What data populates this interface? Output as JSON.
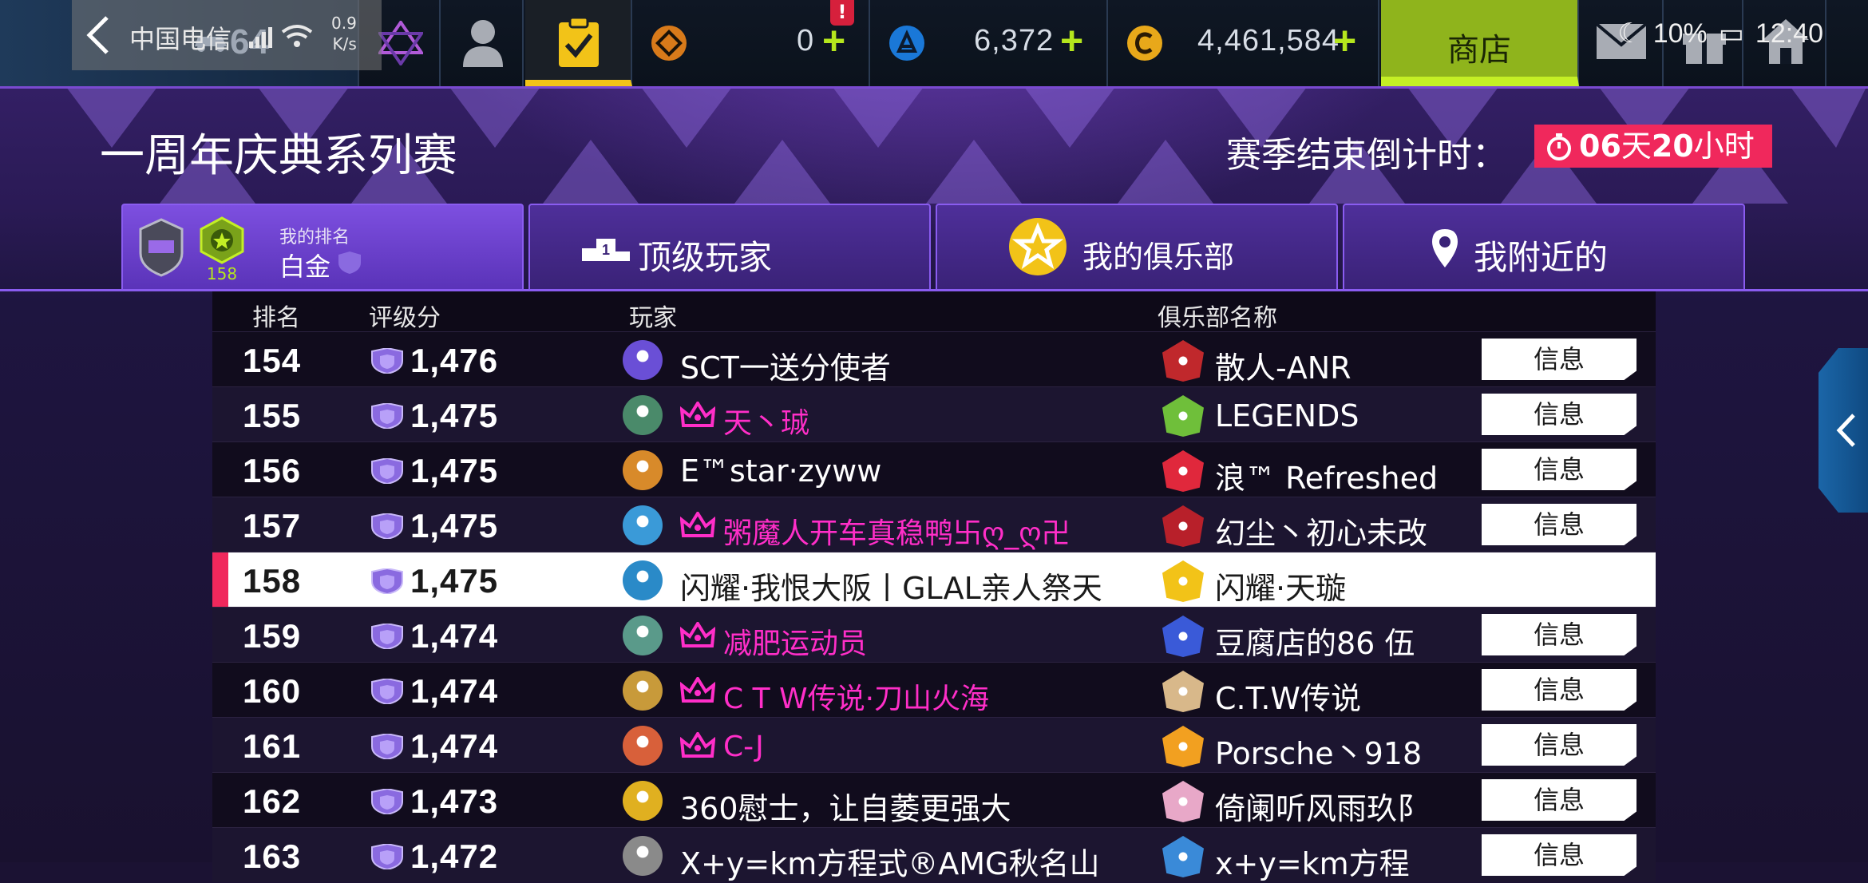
{
  "status_bar": {
    "carrier": "中国电信",
    "network_speed_value": "0.9",
    "network_speed_unit": "K/s",
    "battery": "10%",
    "time": "12:40"
  },
  "top_bar": {
    "car_count": "64",
    "alert_badge": "!",
    "tokens_value": "0",
    "blueprints_value": "6,372",
    "credits_value": "4,461,584",
    "shop_label": "商店",
    "plus_symbol": "+"
  },
  "header": {
    "title": "一周年庆典系列赛",
    "countdown_label": "赛季结束倒计时：",
    "countdown_days": "06",
    "countdown_days_unit": "天",
    "countdown_hours": "20",
    "countdown_hours_unit": "小时"
  },
  "tabs": {
    "my_rank_label": "我的排名",
    "my_rank_tier": "白金",
    "my_level": "158",
    "top_players": "顶级玩家",
    "podium_number": "1",
    "my_club": "我的俱乐部",
    "nearby": "我附近的"
  },
  "table": {
    "headers": {
      "rank": "排名",
      "score": "评级分",
      "player": "玩家",
      "club": "俱乐部名称"
    },
    "info_label": "信息",
    "rows": [
      {
        "rank": "154",
        "score": "1,476",
        "player": "SCT一送分使者",
        "vip": false,
        "club": "散人-ANR",
        "info": true,
        "avatar": "#6a4fd6",
        "logo": "#c0282c"
      },
      {
        "rank": "155",
        "score": "1,475",
        "player": "天丶珹",
        "vip": true,
        "club": "LEGENDS",
        "info": true,
        "avatar": "#4a8a6a",
        "logo": "#6fbf3a"
      },
      {
        "rank": "156",
        "score": "1,475",
        "player": "E™star·zyww",
        "vip": false,
        "club": "浪™ Refreshed",
        "info": true,
        "avatar": "#d88a2a",
        "logo": "#e0283c"
      },
      {
        "rank": "157",
        "score": "1,475",
        "player": "粥魔人开车真稳鸭卐ღ_ღ卍",
        "vip": true,
        "club": "幻尘丶初心未改",
        "info": true,
        "avatar": "#3a9ad8",
        "logo": "#b8202a"
      },
      {
        "rank": "158",
        "score": "1,475",
        "player": "闪耀·我恨大阪丨GLAL亲人祭天",
        "vip": false,
        "club": "闪耀·天璇",
        "info": false,
        "me": true,
        "avatar": "#2a8ac8",
        "logo": "#f2c318"
      },
      {
        "rank": "159",
        "score": "1,474",
        "player": "减肥运动员",
        "vip": true,
        "club": "豆腐店的86 伍",
        "info": true,
        "avatar": "#5a9a8a",
        "logo": "#3a5ad8"
      },
      {
        "rank": "160",
        "score": "1,474",
        "player": "C T W传说·刀山火海",
        "vip": true,
        "club": "C.T.W传说",
        "info": true,
        "avatar": "#c89a3a",
        "logo": "#d8b88a"
      },
      {
        "rank": "161",
        "score": "1,474",
        "player": "C-J",
        "vip": true,
        "club": "Porsche丶918",
        "info": true,
        "avatar": "#d8603a",
        "logo": "#f2a020"
      },
      {
        "rank": "162",
        "score": "1,473",
        "player": "360慰士，让自萎更强大",
        "vip": false,
        "club": "倚阑听风雨玖阝",
        "info": true,
        "avatar": "#e0b020",
        "logo": "#e8a8c8"
      },
      {
        "rank": "163",
        "score": "1,472",
        "player": "X+y=km方程式®AMG秋名山",
        "vip": false,
        "club": "x+y=km方程",
        "info": true,
        "avatar": "#8a8a8a",
        "logo": "#3a8ad8"
      }
    ]
  },
  "colors": {
    "accent_purple": "#8a5cf0",
    "vip_pink": "#ff2ec8",
    "countdown_red": "#f0285c",
    "shop_green": "#8fb41c"
  }
}
